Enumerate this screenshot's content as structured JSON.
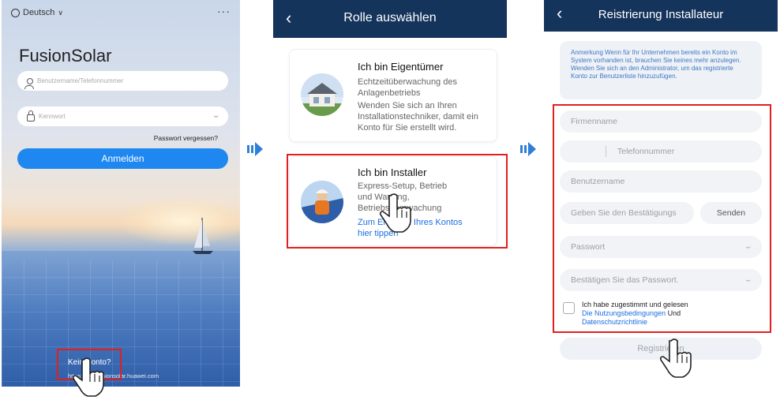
{
  "login": {
    "language": "Deutsch",
    "more": "···",
    "app_name": "FusionSolar",
    "username_placeholder": "Benutzername/Telefonnummer",
    "password_placeholder": "Kennwort",
    "forgot_password": "Passwort vergessen?",
    "login_button": "Anmelden",
    "no_account": "Kein Konto?",
    "url": "https://eu5.fusionsolar.huawei.com"
  },
  "role": {
    "title": "Rolle auswählen",
    "owner": {
      "title": "Ich bin Eigentümer",
      "desc": "Echtzeitüberwachung des Anlagenbetriebs",
      "note": "Wenden Sie sich an Ihren Installationstechniker, damit ein Konto für Sie erstellt wird."
    },
    "installer": {
      "title": "Ich bin Installer",
      "desc": "Express-Setup, Betrieb und Wartung, Betriebsüberwachung",
      "link": "Zum Erstellen Ihres Kontos hier tippen"
    }
  },
  "register": {
    "title": "Reistrierung Installateur",
    "note": "Anmerkung Wenn für Ihr Unternehmen bereits ein Konto im System vorhanden ist, brauchen Sie keines mehr anzulegen. Wenden Sie sich an den Administrator, um das registrierte Konto zur Benutzerliste hinzuzufügen.",
    "company_placeholder": "Firmenname",
    "phone_placeholder": "Telefonnummer",
    "username_placeholder": "Benutzername",
    "code_placeholder": "Geben Sie den Bestätigungs",
    "send_button": "Senden",
    "password_placeholder": "Passwort",
    "confirm_placeholder": "Bestätigen Sie das Passwort.",
    "agree_text": "Ich habe zugestimmt und gelesen",
    "terms_link": "Die Nutzungsbedingungen",
    "and_text": "Und",
    "privacy_link": "Datenschutzrichtlinie",
    "register_button": "Registrieren"
  },
  "colors": {
    "nav_bar": "#14345c",
    "primary_button": "#1e88f0",
    "highlight_box": "#e02020",
    "step_arrow": "#2f7fd6",
    "link": "#1b6fe0"
  }
}
